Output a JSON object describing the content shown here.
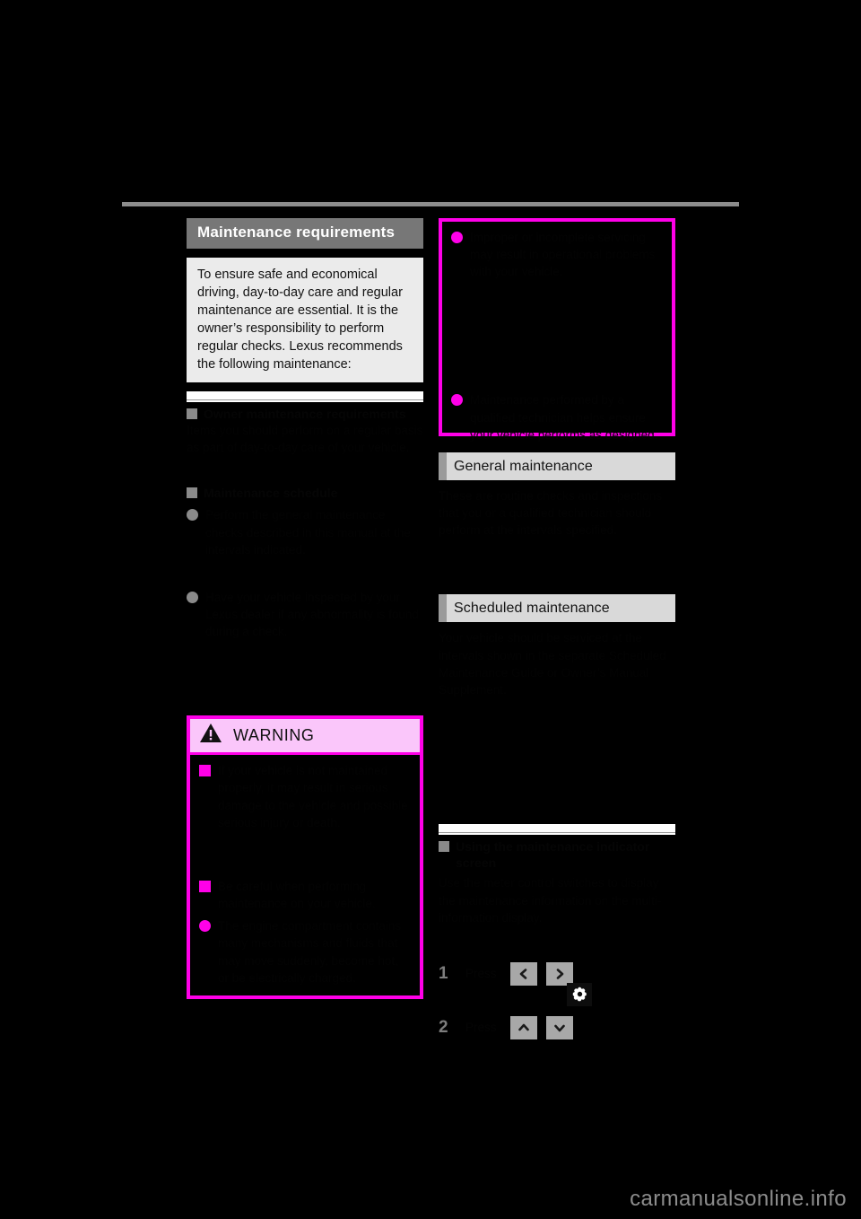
{
  "page": {
    "background_color": "#000000",
    "accent_magenta": "#ff00e8",
    "header_gray": "#777777",
    "section_bar_gray": "#d9d9d9",
    "watermark": "carmanualsonline.info"
  },
  "left_column": {
    "title": "Maintenance requirements",
    "intro": "To ensure safe and economical driving, day-to-day care and regular maintenance are essential. It is the owner’s responsibility to perform regular checks. Lexus recommends the following maintenance:",
    "sections": [
      {
        "heading": "Owner maintenance requirements",
        "body": "Items you should perform on a regular basis as part of day-to-day care of your vehicle.",
        "items": [
          {
            "heading": "Maintenance schedule",
            "body": "Follow the maintenance schedule appropriate for your driving conditions."
          },
          {
            "marker": "dot",
            "body": "Perform the general maintenance checks described in this manual at the intervals indicated."
          },
          {
            "marker": "dot",
            "body": "Have your vehicle inspected by your Lexus dealer if any abnormality is found during a check."
          }
        ]
      }
    ],
    "warning": {
      "title": "WARNING",
      "icon": "warning-triangle-icon",
      "items": [
        {
          "marker": "square",
          "text": "If your vehicle is not maintained properly, it may result in serious damage to the vehicle and possible serious injury or death."
        },
        {
          "marker": "square",
          "text": "Be careful when performing maintenance on your vehicle."
        },
        {
          "marker": "dot",
          "text": "The engine compartment contains many mechanisms and fluids that may move suddenly, become hot, or be electrically charged."
        }
      ]
    }
  },
  "right_column": {
    "info_box": {
      "border_color": "#ff00e8",
      "items": [
        {
          "marker": "dot",
          "text": "Improper or incomplete servicing may result in operational problems with your vehicle."
        },
        {
          "marker": "dot",
          "text": "Maintenance performed by a qualified technician helps ensure your vehicle performs as designed."
        }
      ]
    },
    "sections": [
      {
        "header": "General maintenance",
        "body": "These are routine checks and inspections that you or a qualified technician should perform at the intervals specified."
      },
      {
        "header": "Scheduled maintenance",
        "body": "Your vehicle should be serviced at the intervals shown in the separate Scheduled Maintenance Guide or Owner’s Manual Supplement."
      }
    ],
    "procedure": {
      "heading": "Using the maintenance indicator screen",
      "body": "Use the meter control switches to display the maintenance information on the multi-information display.",
      "steps": [
        {
          "number": "1",
          "label": "Press",
          "buttons": [
            "chevron-left-icon",
            "chevron-right-icon"
          ],
          "extra_icon": "gear-icon"
        },
        {
          "number": "2",
          "label": "Press",
          "buttons": [
            "chevron-up-icon",
            "chevron-down-icon"
          ]
        }
      ]
    }
  }
}
